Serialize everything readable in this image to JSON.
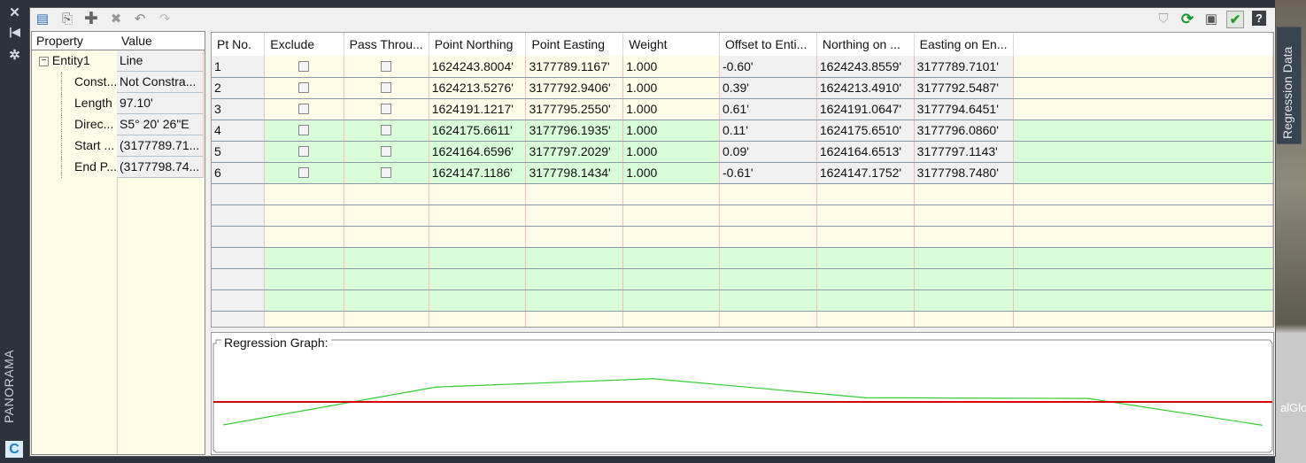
{
  "left_strip": {
    "close_icon": "close-icon",
    "collapse_icon": "collapse-icon",
    "settings_icon": "gear-icon",
    "palette_title": "PANORAMA",
    "app_logo": "C"
  },
  "side_tab": {
    "label": "Regression Data"
  },
  "background_text": "alGlo",
  "toolbar": {
    "left_icons": [
      "import-icon",
      "paste-icon",
      "add-icon",
      "delete-icon",
      "undo-icon",
      "redo-icon"
    ],
    "right_icons": [
      "warning-icon",
      "refresh-icon",
      "save-icon",
      "accept-icon",
      "help-icon"
    ],
    "help_label": "?"
  },
  "properties": {
    "header": {
      "property": "Property",
      "value": "Value"
    },
    "entity": {
      "name": "Entity1",
      "value": "Line"
    },
    "rows": [
      {
        "name": "Const...",
        "value": "Not Constra..."
      },
      {
        "name": "Length",
        "value": "97.10'"
      },
      {
        "name": "Direc...",
        "value": "S5° 20' 26\"E"
      },
      {
        "name": "Start ...",
        "value": "(3177789.71..."
      },
      {
        "name": "End P...",
        "value": "(3177798.74..."
      }
    ]
  },
  "table": {
    "columns": [
      "Pt No.",
      "Exclude",
      "Pass Throu...",
      "Point Northing",
      "Point Easting",
      "Weight",
      "Offset to Enti...",
      "Northing on ...",
      "Easting on En..."
    ],
    "rows": [
      {
        "pt": "1",
        "exclude": false,
        "pass": false,
        "north": "1624243.8004'",
        "east": "3177789.1167'",
        "weight": "1.000",
        "offset": "-0.60'",
        "north_on": "1624243.8559'",
        "east_on": "3177789.7101'"
      },
      {
        "pt": "2",
        "exclude": false,
        "pass": false,
        "north": "1624213.5276'",
        "east": "3177792.9406'",
        "weight": "1.000",
        "offset": "0.39'",
        "north_on": "1624213.4910'",
        "east_on": "3177792.5487'"
      },
      {
        "pt": "3",
        "exclude": false,
        "pass": false,
        "north": "1624191.1217'",
        "east": "3177795.2550'",
        "weight": "1.000",
        "offset": "0.61'",
        "north_on": "1624191.0647'",
        "east_on": "3177794.6451'"
      },
      {
        "pt": "4",
        "exclude": false,
        "pass": false,
        "north": "1624175.6611'",
        "east": "3177796.1935'",
        "weight": "1.000",
        "offset": "0.11'",
        "north_on": "1624175.6510'",
        "east_on": "3177796.0860'"
      },
      {
        "pt": "5",
        "exclude": false,
        "pass": false,
        "north": "1624164.6596'",
        "east": "3177797.2029'",
        "weight": "1.000",
        "offset": "0.09'",
        "north_on": "1624164.6513'",
        "east_on": "3177797.1143'"
      },
      {
        "pt": "6",
        "exclude": false,
        "pass": false,
        "north": "1624147.1186'",
        "east": "3177798.1434'",
        "weight": "1.000",
        "offset": "-0.61'",
        "north_on": "1624147.1752'",
        "east_on": "3177798.7480'"
      }
    ]
  },
  "graph": {
    "title": "Regression Graph:",
    "offsets": [
      -0.6,
      0.39,
      0.61,
      0.11,
      0.09,
      -0.61
    ],
    "x_positions": [
      0,
      0.204,
      0.413,
      0.618,
      0.833,
      1.0
    ],
    "line_color": "#dd0000",
    "data_color": "#33cc33"
  }
}
